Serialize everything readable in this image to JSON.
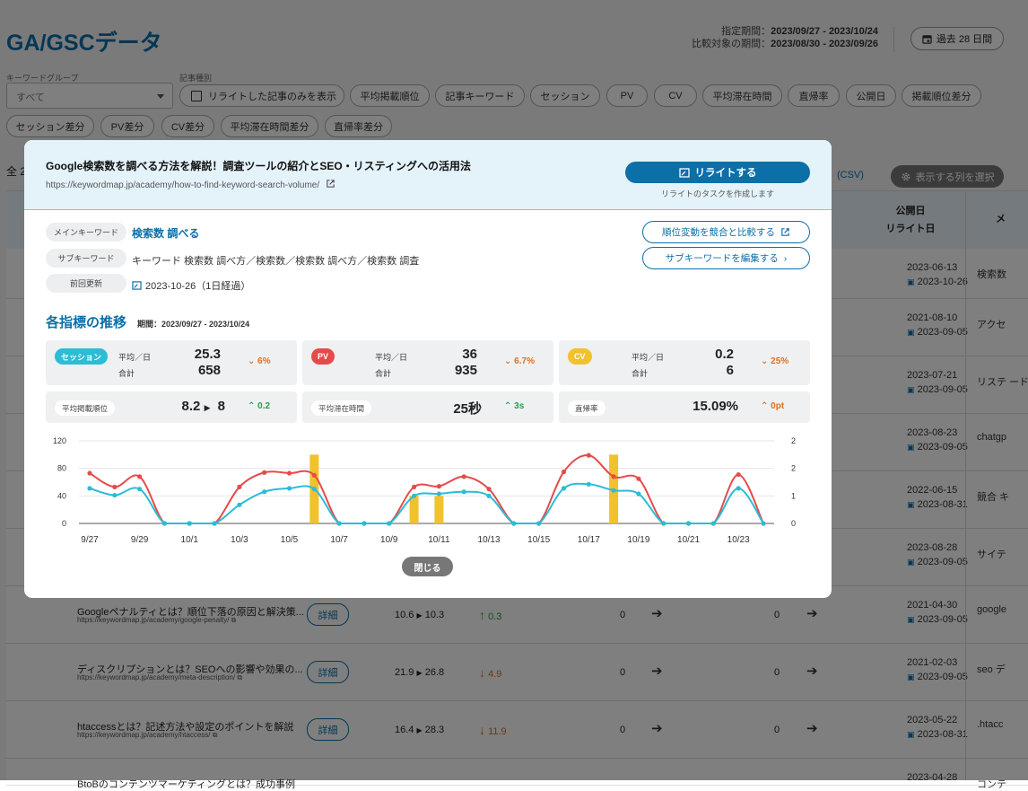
{
  "page": {
    "title": "GA/GSCデータ",
    "period_label": "指定期間：",
    "period_value": "2023/09/27 - 2023/10/24",
    "compare_label": "比較対象の期間：",
    "compare_value": "2023/08/30 - 2023/09/26",
    "range_button": "過去 28 日間"
  },
  "filters": {
    "keyword_group_label": "キーワードグループ",
    "keyword_group_value": "すべて",
    "article_type_label": "記事種別",
    "rewrite_only": "リライトした記事のみを表示",
    "chips": [
      "平均掲載順位",
      "記事キーワード",
      "セッション",
      "PV",
      "CV",
      "平均滞在時間",
      "直帰率",
      "公開日",
      "掲載順位差分",
      "セッション差分",
      "PV差分",
      "CV差分",
      "平均滞在時間差分",
      "直帰率差分"
    ]
  },
  "table": {
    "count_text": "全 2",
    "csv_link": "(CSV)",
    "column_button": "表示する列を選択",
    "header_pub": "公開日",
    "header_rewrite": "リライト日",
    "header_main": "メ",
    "detail_label": "詳細",
    "rows": [
      {
        "date1": "2023-06-13",
        "date2": "2023-10-26",
        "kw": "検索数"
      },
      {
        "date1": "2021-08-10",
        "date2": "2023-09-05",
        "kw": "アクセ"
      },
      {
        "date1": "2023-07-21",
        "date2": "2023-09-05",
        "kw": "リステ ード"
      },
      {
        "date1": "2023-08-23",
        "date2": "2023-09-05",
        "kw": "chatgp"
      },
      {
        "date1": "2022-06-15",
        "date2": "2023-08-31",
        "kw": "競合 キ"
      },
      {
        "date1": "2023-08-28",
        "date2": "2023-09-05",
        "kw": "サイテ"
      },
      {
        "title": "Googleペナルティとは？順位下落の原因と解決策...",
        "url": "https://keywordmap.jp/academy/google-penalty/",
        "rank_from": "10.6",
        "rank_to": "10.3",
        "diff": "0.3",
        "dir": "up",
        "v1": "0",
        "v2": "0",
        "date1": "2021-04-30",
        "date2": "2023-09-05",
        "kw": "google"
      },
      {
        "title": "ディスクリプションとは？SEOへの影響や効果の...",
        "url": "https://keywordmap.jp/academy/meta-description/",
        "rank_from": "21.9",
        "rank_to": "26.8",
        "diff": "4.9",
        "dir": "down",
        "v1": "0",
        "v2": "0",
        "date1": "2021-02-03",
        "date2": "2023-09-05",
        "kw": "seo デ"
      },
      {
        "title": "htaccessとは？記述方法や設定のポイントを解説",
        "url": "https://keywordmap.jp/academy/htaccess/",
        "rank_from": "16.4",
        "rank_to": "28.3",
        "diff": "11.9",
        "dir": "down",
        "v1": "0",
        "v2": "0",
        "date1": "2023-05-22",
        "date2": "2023-08-31",
        "kw": ".htacc"
      },
      {
        "title": "BtoBのコンテンツマーケティングとは？成功事例",
        "date1": "2023-04-28",
        "kw": "コンテ"
      }
    ]
  },
  "modal": {
    "title": "Google検索数を調べる方法を解説！調査ツールの紹介とSEO・リスティングへの活用法",
    "url": "https://keywordmap.jp/academy/how-to-find-keyword-search-volume/",
    "rewrite_button": "リライトする",
    "rewrite_sub": "リライトのタスクを作成します",
    "main_kw_label": "メインキーワード",
    "main_kw": "検索数 調べる",
    "sub_kw_label": "サブキーワード",
    "sub_kw": "キーワード 検索数 調べ方／検索数／検索数 調べ方／検索数 調査",
    "updated_label": "前回更新",
    "updated": "2023-10-26（1日経過）",
    "compare_button": "順位変動を競合と比較する",
    "edit_button": "サブキーワードを編集する",
    "section_title": "各指標の推移",
    "section_period": "期間：2023/09/27 - 2023/10/24",
    "close": "閉じる",
    "metrics": [
      {
        "badge": "セッション",
        "color": "#2bbcd6",
        "l1": "平均／日",
        "v1": "25.3",
        "l2": "合計",
        "v2": "658",
        "delta": "6%",
        "dir": "down"
      },
      {
        "badge": "PV",
        "color": "#e54b4b",
        "l1": "平均／日",
        "v1": "36",
        "l2": "合計",
        "v2": "935",
        "delta": "6.7%",
        "dir": "down"
      },
      {
        "badge": "CV",
        "color": "#f2c12e",
        "l1": "平均／日",
        "v1": "0.2",
        "l2": "合計",
        "v2": "6",
        "delta": "25%",
        "dir": "down"
      }
    ],
    "stats": [
      {
        "label": "平均掲載順位",
        "from": "8.2",
        "to": "8",
        "delta": "0.2",
        "dir": "up"
      },
      {
        "label": "平均滞在時間",
        "value": "25秒",
        "delta": "3s",
        "dir": "up"
      },
      {
        "label": "直帰率",
        "value": "15.09%",
        "delta": "0pt",
        "dir": "up_orange"
      }
    ]
  },
  "chart_data": {
    "type": "line",
    "x": [
      "9/27",
      "9/28",
      "9/29",
      "9/30",
      "10/1",
      "10/2",
      "10/3",
      "10/4",
      "10/5",
      "10/6",
      "10/7",
      "10/8",
      "10/9",
      "10/10",
      "10/11",
      "10/12",
      "10/13",
      "10/14",
      "10/15",
      "10/16",
      "10/17",
      "10/18",
      "10/19",
      "10/20",
      "10/21",
      "10/22",
      "10/23",
      "10/24"
    ],
    "x_tick_labels": [
      "9/27",
      "9/29",
      "10/1",
      "10/3",
      "10/5",
      "10/7",
      "10/9",
      "10/11",
      "10/13",
      "10/15",
      "10/17",
      "10/19",
      "10/21",
      "10/23"
    ],
    "y_left_ticks": [
      "120",
      "80",
      "40",
      "0"
    ],
    "y_right_ticks": [
      "2",
      "2",
      "1",
      "0"
    ],
    "ylim_left": [
      0,
      120
    ],
    "ylim_right": [
      0,
      3
    ],
    "series": [
      {
        "color": "#e54b4b",
        "axis": "left",
        "values": [
          73,
          53,
          68,
          0,
          0,
          0,
          53,
          74,
          73,
          70,
          0,
          0,
          0,
          53,
          54,
          68,
          50,
          0,
          0,
          75,
          99,
          68,
          65,
          0,
          0,
          0,
          71,
          0
        ]
      },
      {
        "color": "#2bbcd6",
        "axis": "left",
        "values": [
          51,
          41,
          50,
          0,
          0,
          0,
          27,
          46,
          51,
          50,
          0,
          0,
          0,
          40,
          43,
          46,
          40,
          0,
          0,
          51,
          57,
          48,
          43,
          0,
          0,
          0,
          51,
          0
        ]
      },
      {
        "color": "#f2c12e",
        "axis": "right",
        "type": "bar",
        "values": [
          0,
          0,
          0,
          0,
          0,
          0,
          0,
          0,
          0,
          2.5,
          0,
          0,
          0,
          1,
          1,
          0,
          0,
          0,
          0,
          0,
          0,
          2.5,
          0,
          0,
          0,
          0,
          0,
          0
        ]
      }
    ]
  }
}
